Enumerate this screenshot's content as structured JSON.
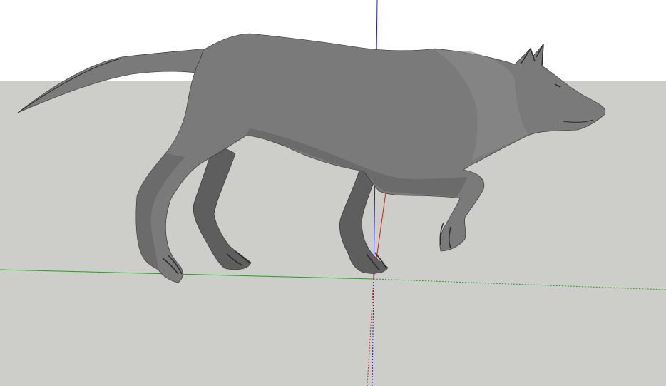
{
  "viewport": {
    "sky_color": "#ffffff",
    "ground_color": "#cdcdc9",
    "axes": {
      "red_axis_color": "#d81f1f",
      "green_axis_color": "#1aa51a",
      "blue_axis_color": "#1c1cd6"
    },
    "model": {
      "name": "wolf",
      "body_color": "#7a7a7a",
      "shade_color": "#5e5e5e",
      "light_color": "#8a8a8a",
      "edge_color": "#2a2a2a"
    }
  }
}
